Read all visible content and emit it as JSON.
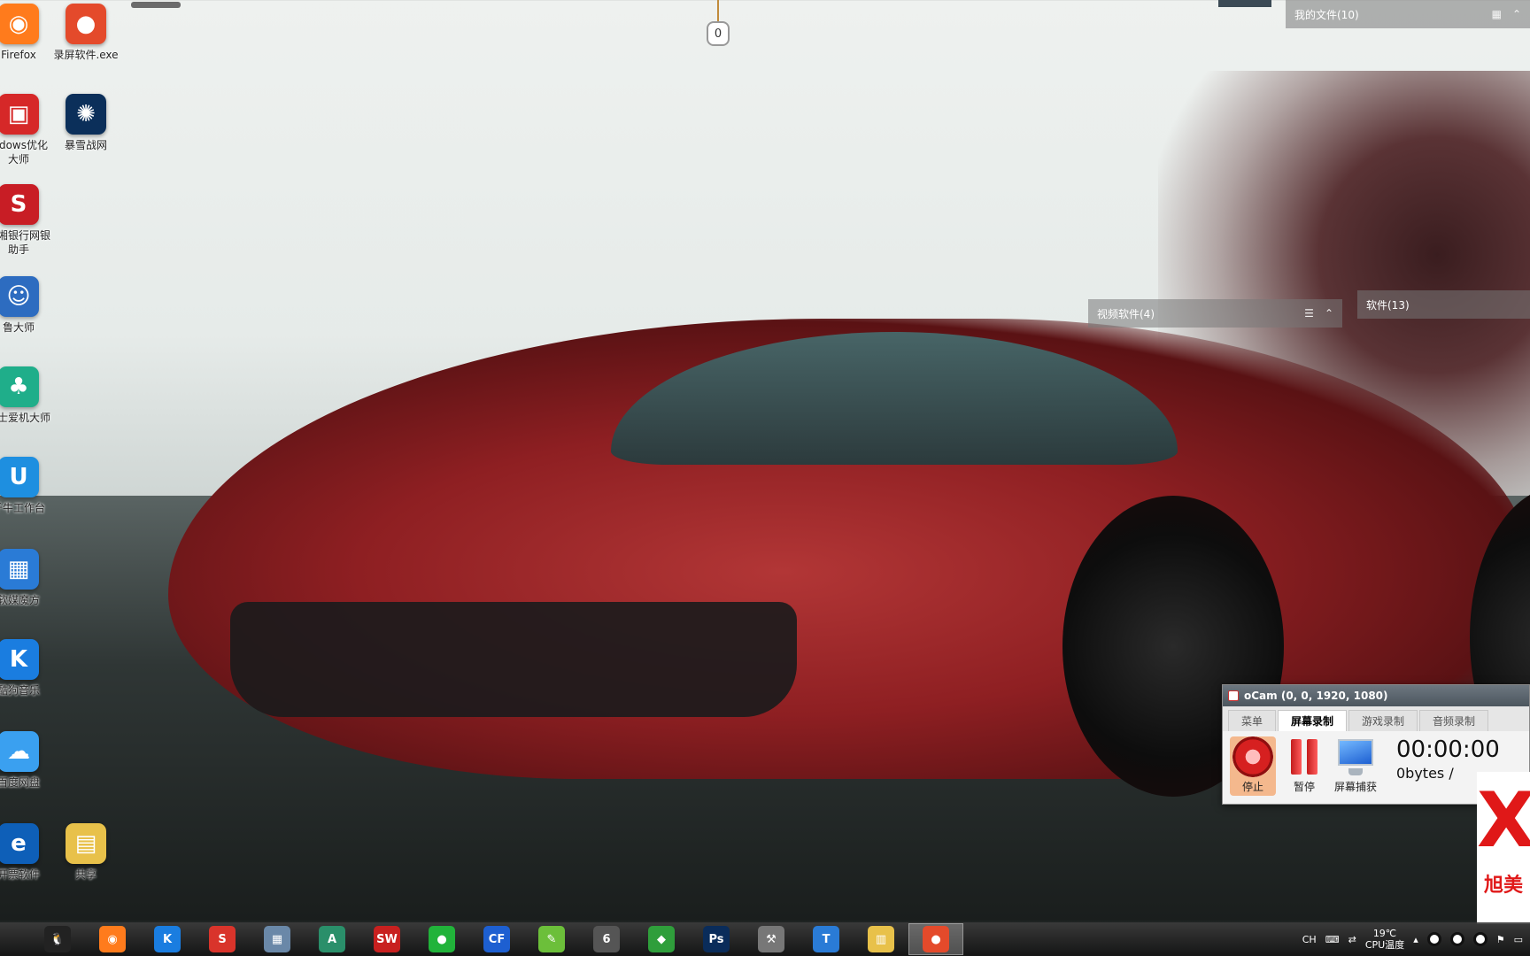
{
  "desktop": {
    "icons": [
      {
        "label": "Firefox",
        "glyph": "◉",
        "color": "#ff7b1c"
      },
      {
        "label": "录屏软件.exe",
        "glyph": "●",
        "color": "#e44a2b"
      },
      {
        "label": "indows优化大师",
        "glyph": "▣",
        "color": "#d62828"
      },
      {
        "label": "暴雪战网",
        "glyph": "✺",
        "color": "#0b2f5a"
      },
      {
        "label": "兴湘银行网银助手",
        "glyph": "S",
        "color": "#c81d25"
      },
      {
        "label": "鲁大师",
        "glyph": "☺",
        "color": "#2d6cc0"
      },
      {
        "label": "博士爱机大师",
        "glyph": "♣",
        "color": "#1fae8a"
      },
      {
        "label": "千牛工作台",
        "glyph": "U",
        "color": "#1e8fe0"
      },
      {
        "label": "软媒魔方",
        "glyph": "▦",
        "color": "#2a7bd6"
      },
      {
        "label": "酷狗音乐",
        "glyph": "K",
        "color": "#1a7de0"
      },
      {
        "label": "百度网盘",
        "glyph": "☁",
        "color": "#3aa0f0"
      },
      {
        "label": "开票软件",
        "glyph": "e",
        "color": "#0e5fb8"
      },
      {
        "label": "共享",
        "glyph": "▤",
        "color": "#e8c14a"
      }
    ]
  },
  "fences": {
    "my_files": "我的文件(10)",
    "video_software": "视频软件(4)",
    "software": "软件(13)"
  },
  "ocam": {
    "title": "oCam (0, 0, 1920, 1080)",
    "tabs": [
      "菜单",
      "屏幕录制",
      "游戏录制",
      "音频录制"
    ],
    "active_tab": 1,
    "stop_label": "停止",
    "pause_label": "暂停",
    "capture_label": "屏幕捕获",
    "time": "00:00:00",
    "size": "0bytes /"
  },
  "ad": {
    "mark": "X",
    "brand": "旭美"
  },
  "taskbar": {
    "apps": [
      {
        "name": "qq",
        "glyph": "🐧",
        "color": "#222"
      },
      {
        "name": "firefox",
        "glyph": "◉",
        "color": "#ff7b1c"
      },
      {
        "name": "kugou",
        "glyph": "K",
        "color": "#1a7de0"
      },
      {
        "name": "wps",
        "glyph": "S",
        "color": "#d9342b"
      },
      {
        "name": "calculator",
        "glyph": "▦",
        "color": "#6a88a8"
      },
      {
        "name": "autocad",
        "glyph": "A",
        "color": "#2a8f6a"
      },
      {
        "name": "solidworks",
        "glyph": "SW",
        "color": "#c8201f"
      },
      {
        "name": "wechat",
        "glyph": "●",
        "color": "#21b33a"
      },
      {
        "name": "cf",
        "glyph": "CF",
        "color": "#1d5fd1"
      },
      {
        "name": "app-green",
        "glyph": "✎",
        "color": "#6cbf3a"
      },
      {
        "name": "rhino",
        "glyph": "6",
        "color": "#555"
      },
      {
        "name": "coreldraw",
        "glyph": "◆",
        "color": "#2f9e3b"
      },
      {
        "name": "photoshop",
        "glyph": "Ps",
        "color": "#0a2c5a"
      },
      {
        "name": "tool",
        "glyph": "⚒",
        "color": "#777"
      },
      {
        "name": "app-t",
        "glyph": "T",
        "color": "#2a7bd6"
      },
      {
        "name": "explorer",
        "glyph": "▥",
        "color": "#e8c14a"
      },
      {
        "name": "ocam",
        "glyph": "●",
        "color": "#e44a2b"
      }
    ],
    "tray": {
      "lang": "CH",
      "temp": "19℃",
      "temp_label": "CPU温度"
    }
  },
  "hang_tag": "0"
}
